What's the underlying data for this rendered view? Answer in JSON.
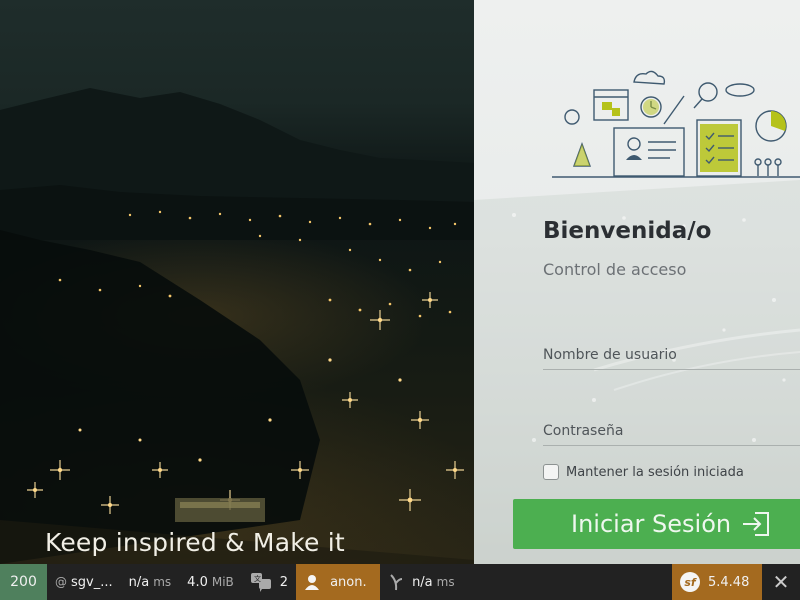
{
  "hero": {
    "caption": "Keep inspired & Make it"
  },
  "login": {
    "title": "Bienvenida/o",
    "subtitle": "Control de acceso",
    "username_placeholder": "Nombre de usuario",
    "password_placeholder": "Contraseña",
    "remember_label": "Mantener la sesión iniciada",
    "submit_label": "Iniciar Sesión",
    "accent_color": "#4caf50"
  },
  "toolbar": {
    "status_code": "200",
    "route": "sgv_...",
    "time_value": "n/a",
    "time_unit": "ms",
    "memory_value": "4.0",
    "memory_unit": "MiB",
    "translations_count": "2",
    "user": "anon.",
    "render_value": "n/a",
    "render_unit": "ms",
    "version": "5.4.48",
    "status_color": "#4f805d",
    "user_color": "#a46a1f"
  }
}
